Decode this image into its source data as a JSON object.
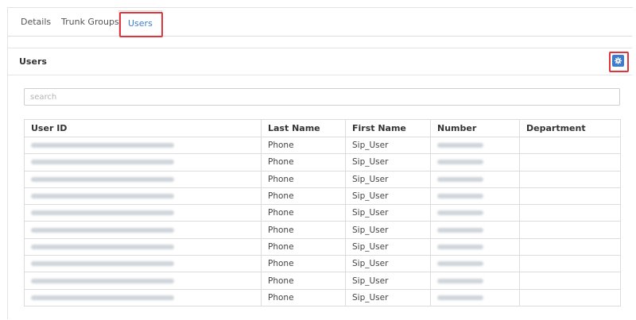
{
  "tabs": [
    {
      "label": "Details",
      "active": false
    },
    {
      "label": "Trunk Groups",
      "active": false
    },
    {
      "label": "Users",
      "active": true
    }
  ],
  "panel": {
    "title": "Users",
    "settings_icon": "gear-icon"
  },
  "search": {
    "placeholder": "search"
  },
  "table": {
    "columns": [
      "User ID",
      "Last Name",
      "First Name",
      "Number",
      "Department"
    ],
    "rows": [
      {
        "last_name": "Phone",
        "first_name": "Sip_User"
      },
      {
        "last_name": "Phone",
        "first_name": "Sip_User"
      },
      {
        "last_name": "Phone",
        "first_name": "Sip_User"
      },
      {
        "last_name": "Phone",
        "first_name": "Sip_User"
      },
      {
        "last_name": "Phone",
        "first_name": "Sip_User"
      },
      {
        "last_name": "Phone",
        "first_name": "Sip_User"
      },
      {
        "last_name": "Phone",
        "first_name": "Sip_User"
      },
      {
        "last_name": "Phone",
        "first_name": "Sip_User"
      },
      {
        "last_name": "Phone",
        "first_name": "Sip_User"
      },
      {
        "last_name": "Phone",
        "first_name": "Sip_User"
      }
    ]
  },
  "colors": {
    "accent": "#3a7bd5",
    "gear_button": "#3d7ccc",
    "highlight": "#e0353a"
  }
}
